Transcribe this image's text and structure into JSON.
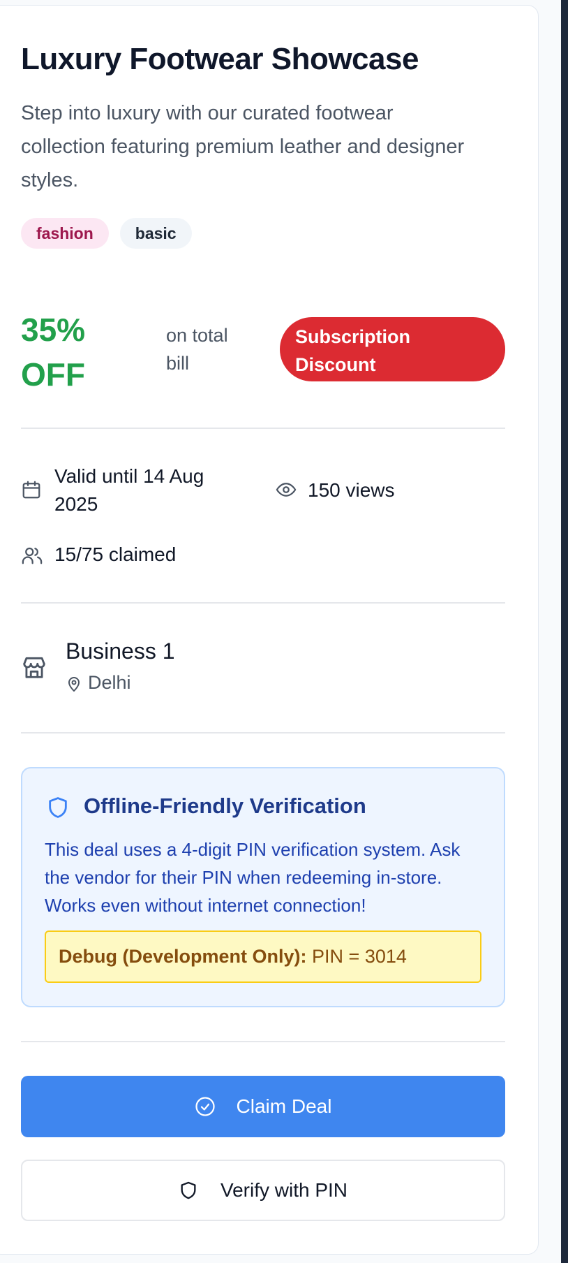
{
  "deal": {
    "title": "Luxury Footwear Showcase",
    "description": "Step into luxury with our curated footwear collection featuring premium leather and designer styles.",
    "tags": [
      "fashion",
      "basic"
    ],
    "discount": "35% OFF",
    "discount_scope": "on total bill",
    "type_badge": "Subscription Discount"
  },
  "meta": {
    "valid_until": "Valid until 14 Aug 2025",
    "views": "150 views",
    "claimed": "15/75 claimed"
  },
  "business": {
    "name": "Business 1",
    "location": "Delhi"
  },
  "verification": {
    "title": "Offline-Friendly Verification",
    "text": "This deal uses a 4-digit PIN verification system. Ask the vendor for their PIN when redeeming in-store. Works even without internet connection!",
    "debug_label": "Debug (Development Only):",
    "debug_value": "PIN = 3014"
  },
  "actions": {
    "claim_label": "Claim Deal",
    "verify_label": "Verify with PIN"
  },
  "colors": {
    "discount": "#22a04b",
    "badge": "#dc2b32",
    "primary": "#3f86ef",
    "tag_fashion_bg": "#fce7f3",
    "verify_bg": "#eef5ff"
  },
  "icons": [
    "calendar-icon",
    "eye-icon",
    "users-icon",
    "store-icon",
    "map-pin-icon",
    "shield-icon",
    "check-circle-icon"
  ]
}
